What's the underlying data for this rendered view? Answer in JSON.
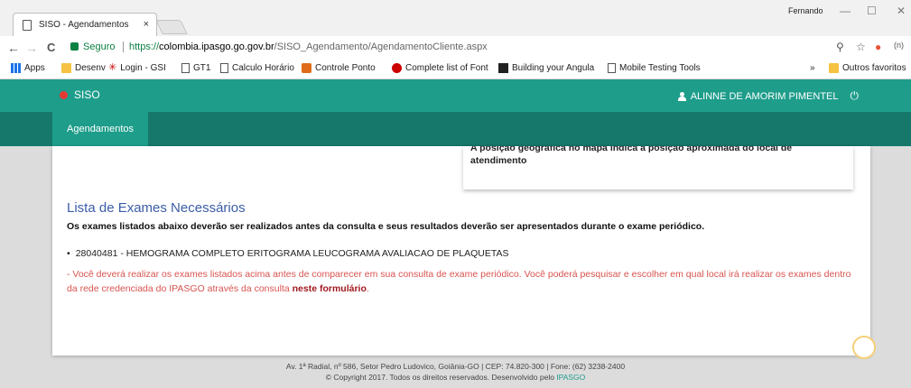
{
  "browser": {
    "tab_title": "SISO - Agendamentos",
    "tab_close": "×",
    "profile_name": "Fernando",
    "window_controls": [
      "—",
      "☐",
      "✕"
    ],
    "nav_back": "←",
    "nav_forward": "→",
    "nav_reload": "C",
    "secure_label": "Seguro",
    "url_scheme": "https://",
    "url_host": "colombia.ipasgo.go.gov.br",
    "url_path": "/SISO_Agendamento/AgendamentoCliente.aspx",
    "bookmark_star": "☆",
    "overflow": "»",
    "bookmarks": [
      {
        "label": "Apps",
        "icon": "grid"
      },
      {
        "label": "Desenv",
        "icon": "folder"
      },
      {
        "label": "Login - GSI",
        "icon": "star"
      },
      {
        "label": "GT1",
        "icon": "page"
      },
      {
        "label": "Calculo Horário",
        "icon": "page"
      },
      {
        "label": "Controle Ponto",
        "icon": "cal"
      },
      {
        "label": "Complete list of Font",
        "icon": "dot"
      },
      {
        "label": "Building your Angula",
        "icon": "black"
      },
      {
        "label": "Mobile Testing Tools",
        "icon": "page"
      },
      {
        "label": "Outros favoritos",
        "icon": "folder"
      }
    ]
  },
  "app": {
    "brand": "SISO",
    "user_name": "ALINNE DE AMORIM PIMENTEL",
    "nav_items": [
      "Agendamentos"
    ]
  },
  "content": {
    "map_note_line1": "A posição geográfica no mapa indica a posição aproximada do local de",
    "map_note_line2": "atendimento",
    "section_title": "Lista de Exames Necessários",
    "section_subtitle": "Os exames listados abaixo deverão ser realizados antes da consulta e seus resultados deverão ser apresentados durante o exame periódico.",
    "exams": [
      "28040481 - HEMOGRAMA COMPLETO ERITOGRAMA LEUCOGRAMA AVALIACAO DE PLAQUETAS"
    ],
    "warning_text": "- Você deverá realizar os exames listados acima antes de comparecer em sua consulta de exame periódico. Você poderá pesquisar e escolher em qual local irá realizar os exames dentro da rede credenciada do IPASGO através da consulta ",
    "warning_link": "neste formulário",
    "warning_end": "."
  },
  "footer": {
    "address": "Av. 1ª Radial, nº 586, Setor Pedro Ludovico, Goiânia-GO | CEP: 74.820-300 | Fone: (62) 3238-2400",
    "copyright": "© Copyright 2017. Todos os direitos reservados. Desenvolvido pelo ",
    "developer": "IPASGO"
  },
  "colors": {
    "header": "#1e9d8b",
    "navbar": "#15786b",
    "title": "#3a5ca8",
    "warning": "#d9534f"
  }
}
